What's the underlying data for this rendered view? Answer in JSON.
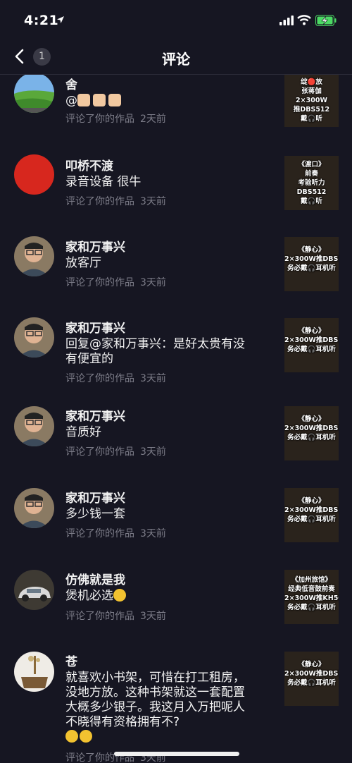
{
  "status_bar": {
    "time": "4:21"
  },
  "nav": {
    "title": "评论",
    "badge_count": "1"
  },
  "comments": [
    {
      "username": "舍",
      "text": "@",
      "action": "评论了你的作品",
      "when": "2天前",
      "thumb_text": "绽🔴放\n张蒋伽\n2×300W\n推DBS512\n戴🎧听"
    },
    {
      "username": "叩桥不渡",
      "text": "录音设备 很牛",
      "action": "评论了你的作品",
      "when": "3天前",
      "thumb_text": "《渡口》\n前奏\n考验听力\nDBS512\n戴🎧听"
    },
    {
      "username": "家和万事兴",
      "text": "放客厅",
      "action": "评论了你的作品",
      "when": "3天前",
      "thumb_text": "《静心》\n2×300W推DBS512\n务必戴🎧耳机听"
    },
    {
      "username": "家和万事兴",
      "text": "回复@家和万事兴：是好太贵有没有便宜的",
      "action": "评论了你的作品",
      "when": "3天前",
      "thumb_text": "《静心》\n2×300W推DBS512\n务必戴🎧耳机听"
    },
    {
      "username": "家和万事兴",
      "text": "音质好",
      "action": "评论了你的作品",
      "when": "3天前",
      "thumb_text": "《静心》\n2×300W推DBS512\n务必戴🎧耳机听"
    },
    {
      "username": "家和万事兴",
      "text": "多少钱一套",
      "action": "评论了你的作品",
      "when": "3天前",
      "thumb_text": "《静心》\n2×300W推DBS512\n务必戴🎧耳机听"
    },
    {
      "username": "仿佛就是我",
      "text": "煲机必选",
      "action": "评论了你的作品",
      "when": "3天前",
      "thumb_text": "《加州旅馆》\n经典低音鼓前奏\n2×300W推KH503\n务必戴🎧耳机听"
    },
    {
      "username": "苍",
      "text": "就喜欢小书架，可惜在打工租房，没地方放。这种书架就这一套配置大概多少银子。我这月入万把呢人不晓得有资格拥有不?",
      "action": "评论了你的作品",
      "when": "3天前",
      "thumb_text": "《静心》\n2×300W推DBS512\n务必戴🎧耳机听"
    }
  ],
  "colors": {
    "background": "#161622",
    "meta_text": "#7c7c88",
    "battery_green": "#4cd964"
  }
}
